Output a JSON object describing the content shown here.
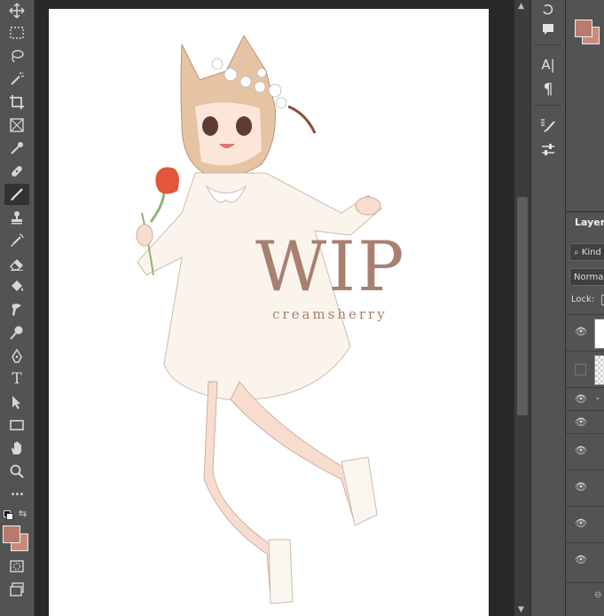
{
  "toolbar": {
    "tools": [
      {
        "name": "move-tool",
        "icon": "move-icon"
      },
      {
        "name": "marquee-tool",
        "icon": "rect-marquee-icon"
      },
      {
        "name": "lasso-tool",
        "icon": "lasso-icon"
      },
      {
        "name": "magic-wand-tool",
        "icon": "magic-wand-icon"
      },
      {
        "name": "crop-tool",
        "icon": "crop-icon"
      },
      {
        "name": "frame-tool",
        "icon": "frame-icon"
      },
      {
        "name": "eyedropper-tool",
        "icon": "eyedropper-icon"
      },
      {
        "name": "healing-brush-tool",
        "icon": "bandage-icon"
      },
      {
        "name": "brush-tool",
        "icon": "brush-icon",
        "active": true
      },
      {
        "name": "clone-stamp-tool",
        "icon": "stamp-icon"
      },
      {
        "name": "history-brush-tool",
        "icon": "history-brush-icon"
      },
      {
        "name": "eraser-tool",
        "icon": "eraser-icon"
      },
      {
        "name": "paint-bucket-tool",
        "icon": "bucket-icon"
      },
      {
        "name": "smudge-tool",
        "icon": "smudge-icon"
      },
      {
        "name": "dodge-tool",
        "icon": "dodge-icon"
      },
      {
        "name": "pen-tool",
        "icon": "pen-icon"
      },
      {
        "name": "type-tool",
        "icon": "type-icon",
        "glyph": "T"
      },
      {
        "name": "path-selection-tool",
        "icon": "arrow-icon"
      },
      {
        "name": "rectangle-tool",
        "icon": "rectangle-icon"
      },
      {
        "name": "hand-tool",
        "icon": "hand-icon"
      },
      {
        "name": "zoom-tool",
        "icon": "zoom-icon"
      },
      {
        "name": "more-tools",
        "icon": "ellipsis-icon",
        "glyph": "•••"
      }
    ],
    "foreground_color": "#b87b6b",
    "background_color": "#c98a7a"
  },
  "canvas": {
    "watermark_text": "WIP",
    "signature_text": "creamsherry",
    "watermark_color": "#a88070"
  },
  "panels": {
    "swatch_foreground": "#b97b6d",
    "swatch_background": "#c88b7c",
    "layers_tab_label": "Layers",
    "filter_kind": "Kind",
    "blend_mode": "Normal",
    "lock_label": "Lock:",
    "character_icon_glyph": "A|",
    "paragraph_icon_glyph": "¶"
  },
  "colors": {
    "app_bg": "#282828",
    "panel_bg": "#535353",
    "accent_text": "#e0e0e0"
  }
}
